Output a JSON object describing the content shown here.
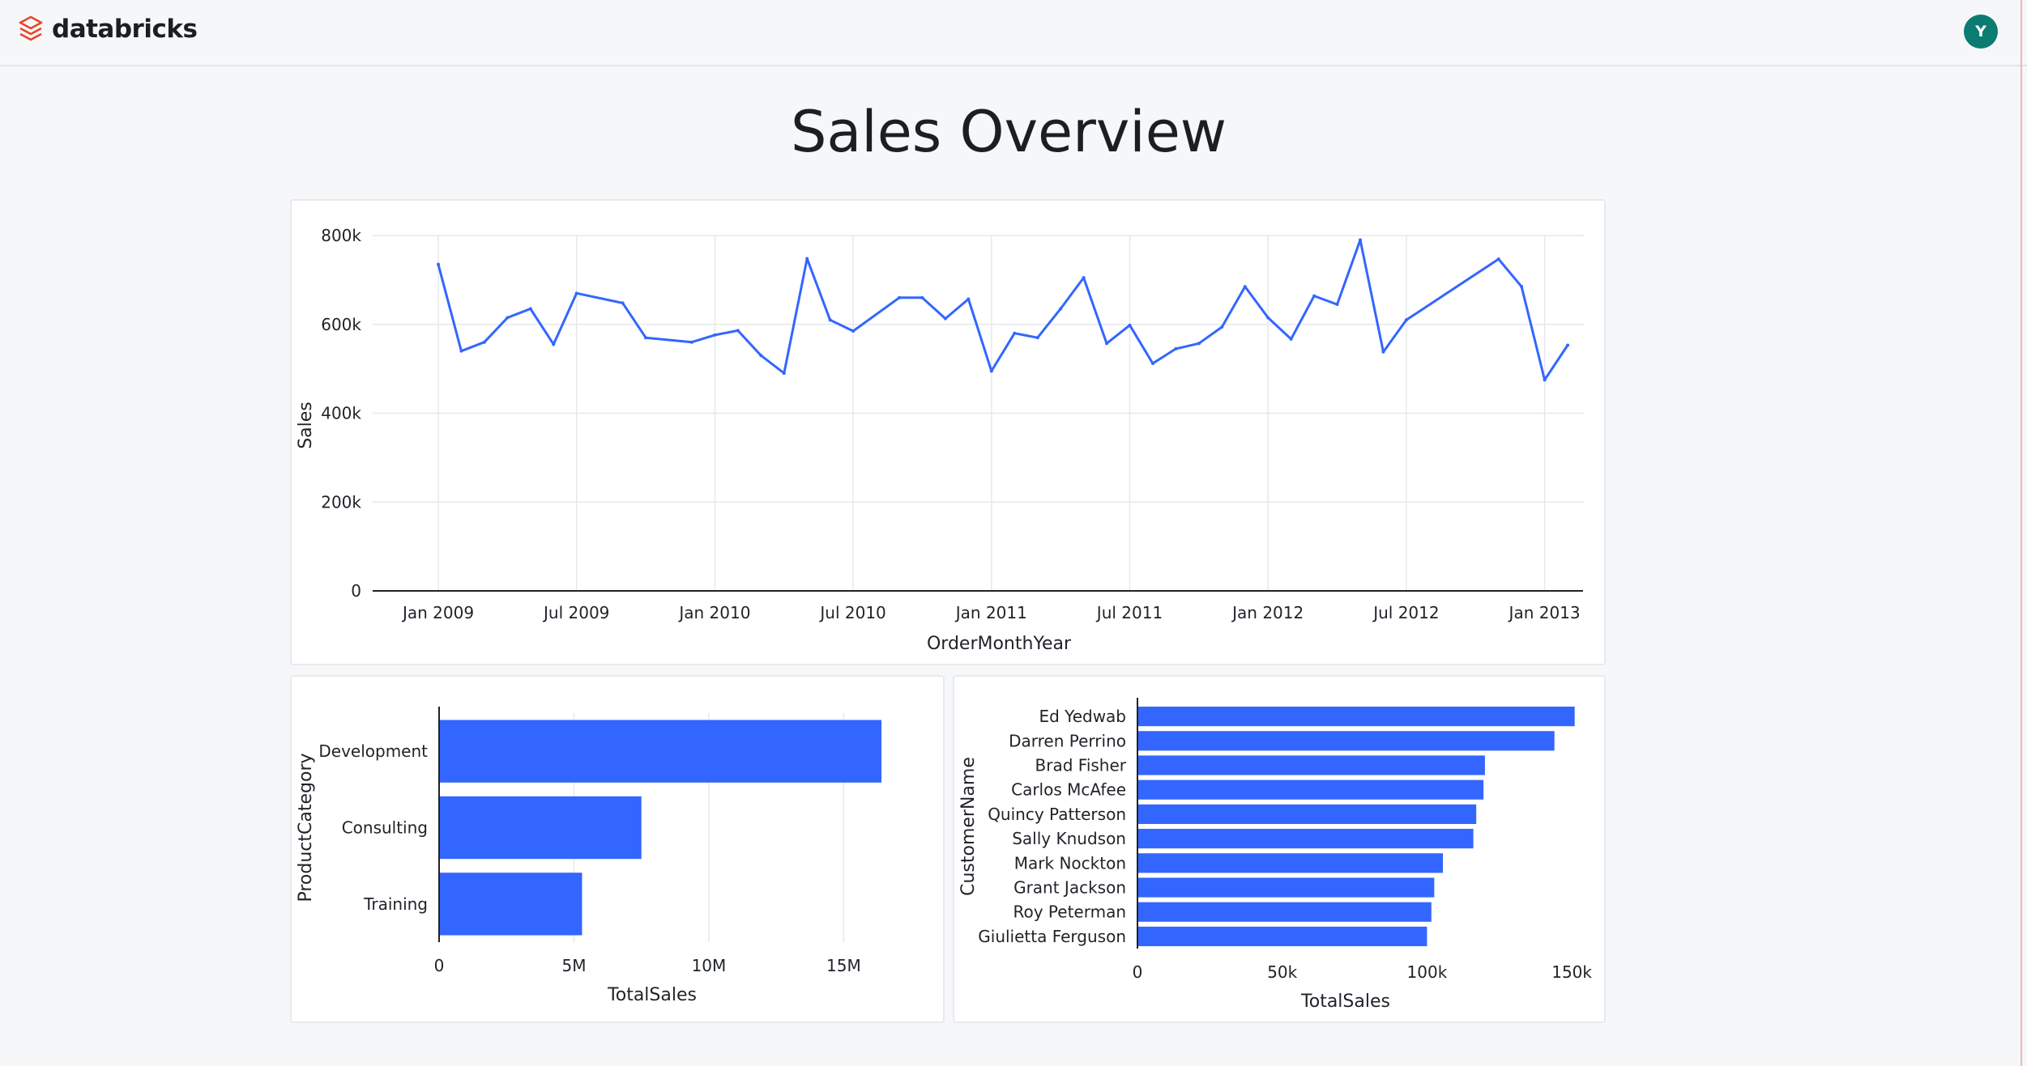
{
  "app": {
    "brand": "databricks",
    "user_initial": "Y"
  },
  "page": {
    "title": "Sales Overview"
  },
  "colors": {
    "series": "#3366ff",
    "avatar": "#0c7c72",
    "brand": "#e8452c"
  },
  "icons": {
    "brand": "databricks-logo-icon"
  },
  "chart_data": [
    {
      "type": "line",
      "xlabel": "OrderMonthYear",
      "ylabel": "Sales",
      "ylim": [
        0,
        800000
      ],
      "yticks": [
        "0",
        "200k",
        "400k",
        "600k",
        "800k"
      ],
      "xticks": [
        "Jan 2009",
        "Jul 2009",
        "Jan 2010",
        "Jul 2010",
        "Jan 2011",
        "Jul 2011",
        "Jan 2012",
        "Jul 2012",
        "Jan 2013"
      ],
      "grid": true,
      "x": [
        "2009-01",
        "2009-02",
        "2009-03",
        "2009-04",
        "2009-05",
        "2009-06",
        "2009-07",
        "2009-09",
        "2009-10",
        "2009-12",
        "2010-01",
        "2010-02",
        "2010-03",
        "2010-04",
        "2010-05",
        "2010-06",
        "2010-07",
        "2010-09",
        "2010-10",
        "2010-11",
        "2010-12",
        "2011-01",
        "2011-02",
        "2011-03",
        "2011-04",
        "2011-05",
        "2011-06",
        "2011-07",
        "2011-08",
        "2011-09",
        "2011-10",
        "2011-11",
        "2011-12",
        "2012-01",
        "2012-02",
        "2012-03",
        "2012-04",
        "2012-05",
        "2012-06",
        "2012-07",
        "2012-11",
        "2012-12",
        "2013-01",
        "2013-02"
      ],
      "series": [
        {
          "values": [
            735000,
            540000,
            560000,
            615000,
            635000,
            555000,
            670000,
            648000,
            570000,
            560000,
            576000,
            586000,
            530000,
            490000,
            748000,
            610000,
            585000,
            660000,
            660000,
            613000,
            657000,
            495000,
            580000,
            570000,
            635000,
            705000,
            557000,
            598000,
            512000,
            545000,
            557000,
            594000,
            685000,
            615000,
            567000,
            664000,
            645000,
            790000,
            538000,
            610000,
            747000,
            685000,
            475000,
            553000
          ]
        }
      ]
    },
    {
      "type": "bar",
      "orientation": "horizontal",
      "ylabel": "ProductCategory",
      "xlabel": "TotalSales",
      "categories": [
        "Development",
        "Consulting",
        "Training"
      ],
      "values": [
        16400000,
        7500000,
        5300000
      ],
      "xlim": [
        0,
        17000000
      ],
      "xticks": [
        "0",
        "5M",
        "10M",
        "15M"
      ],
      "grid": true
    },
    {
      "type": "bar",
      "orientation": "horizontal",
      "ylabel": "CustomerName",
      "xlabel": "TotalSales",
      "categories": [
        "Ed Yedwab",
        "Darren Perrino",
        "Brad Fisher",
        "Carlos McAfee",
        "Quincy Patterson",
        "Sally Knudson",
        "Mark Nockton",
        "Grant Jackson",
        "Roy Peterman",
        "Giulietta Ferguson"
      ],
      "values": [
        151000,
        144000,
        120000,
        119500,
        117000,
        116000,
        105500,
        102500,
        101500,
        100000
      ],
      "xlim": [
        0,
        155000
      ],
      "xticks": [
        "0",
        "50k",
        "100k",
        "150k"
      ],
      "grid": false
    }
  ]
}
